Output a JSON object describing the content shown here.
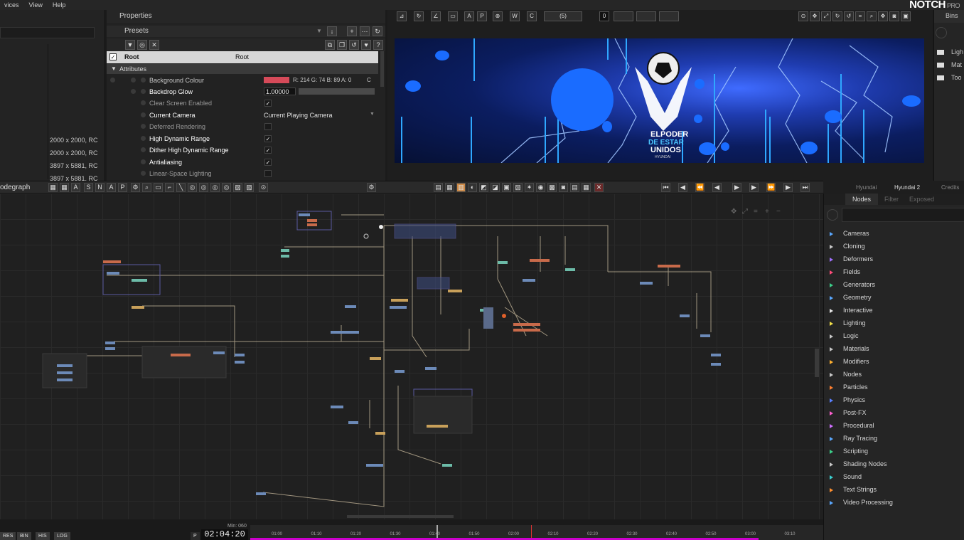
{
  "menubar": {
    "items": [
      "vices",
      "View",
      "Help"
    ],
    "logo": "NOTCH",
    "logo_sub": "PRO"
  },
  "resources": {
    "rows": [
      "2000 x 2000, RC",
      "2000 x 2000, RC",
      "3897 x 5881, RC",
      "3897 x 5881, RC"
    ]
  },
  "properties": {
    "title": "Properties",
    "presets_label": "Presets",
    "root_name": "Root",
    "root_type": "Root",
    "attributes_label": "Attributes",
    "rows": [
      {
        "label": "Background Colour",
        "value": "R: 214 G: 74 B: 89 A: 0",
        "extra": "C"
      },
      {
        "label": "Backdrop Glow",
        "value": "1.00000"
      },
      {
        "label": "Clear Screen Enabled",
        "check": "✓"
      },
      {
        "label": "Current Camera",
        "value": "Current Playing Camera"
      },
      {
        "label": "Deferred Rendering",
        "check": ""
      },
      {
        "label": "High Dynamic Range",
        "check": "✓"
      },
      {
        "label": "Dither High Dynamic Range",
        "check": "✓"
      },
      {
        "label": "Antialiasing",
        "check": "✓"
      },
      {
        "label": "Linear-Space Lighting",
        "check": ""
      }
    ],
    "bg_colour": "#d64a59"
  },
  "viewport": {
    "counter": "0",
    "frame_box": "(5)",
    "logo_line1": "ELPODER",
    "logo_line2": "DE ESTAR",
    "logo_line3": "UNIDOS",
    "logo_line4": "HYUNDAI"
  },
  "bins": {
    "title": "Bins",
    "items": [
      "Ligh",
      "Mat",
      "Too"
    ]
  },
  "nodegraph": {
    "title": "odegraph"
  },
  "right_tabs": [
    "Hyundai",
    "Hyundai 2",
    "Credits"
  ],
  "nodes_panel": {
    "tabs": [
      "Nodes",
      "Filter",
      "Exposed"
    ],
    "categories": [
      {
        "label": "Cameras",
        "color": "#5aa8ff"
      },
      {
        "label": "Cloning",
        "color": "#c8c8c8"
      },
      {
        "label": "Deformers",
        "color": "#a070ff"
      },
      {
        "label": "Fields",
        "color": "#ff4c7a"
      },
      {
        "label": "Generators",
        "color": "#3ccf8a"
      },
      {
        "label": "Geometry",
        "color": "#5aa8ff"
      },
      {
        "label": "Interactive",
        "color": "#e8e8e8"
      },
      {
        "label": "Lighting",
        "color": "#f2e04a"
      },
      {
        "label": "Logic",
        "color": "#c8c8c8"
      },
      {
        "label": "Materials",
        "color": "#c8c8c8"
      },
      {
        "label": "Modifiers",
        "color": "#ffb030"
      },
      {
        "label": "Nodes",
        "color": "#c8c8c8"
      },
      {
        "label": "Particles",
        "color": "#ff8030"
      },
      {
        "label": "Physics",
        "color": "#5a80ff"
      },
      {
        "label": "Post-FX",
        "color": "#ff60d0"
      },
      {
        "label": "Procedural",
        "color": "#d070ff"
      },
      {
        "label": "Ray Tracing",
        "color": "#5aa8ff"
      },
      {
        "label": "Scripting",
        "color": "#3ccf8a"
      },
      {
        "label": "Shading Nodes",
        "color": "#c8c8c8"
      },
      {
        "label": "Sound",
        "color": "#3cd0d0"
      },
      {
        "label": "Text Strings",
        "color": "#ff9030"
      },
      {
        "label": "Video Processing",
        "color": "#5aa8ff"
      }
    ]
  },
  "bottom": {
    "tabs": [
      "RES",
      "BIN",
      "HIS",
      "LOG"
    ],
    "time": "02:04:20",
    "min_label": "Min: 060",
    "ticks": [
      "01:00",
      "01:10",
      "01:20",
      "01:30",
      "01:40",
      "01:50",
      "02:00",
      "02:10",
      "02:20",
      "02:30",
      "02:40",
      "02:50",
      "03:00",
      "03:10"
    ]
  }
}
